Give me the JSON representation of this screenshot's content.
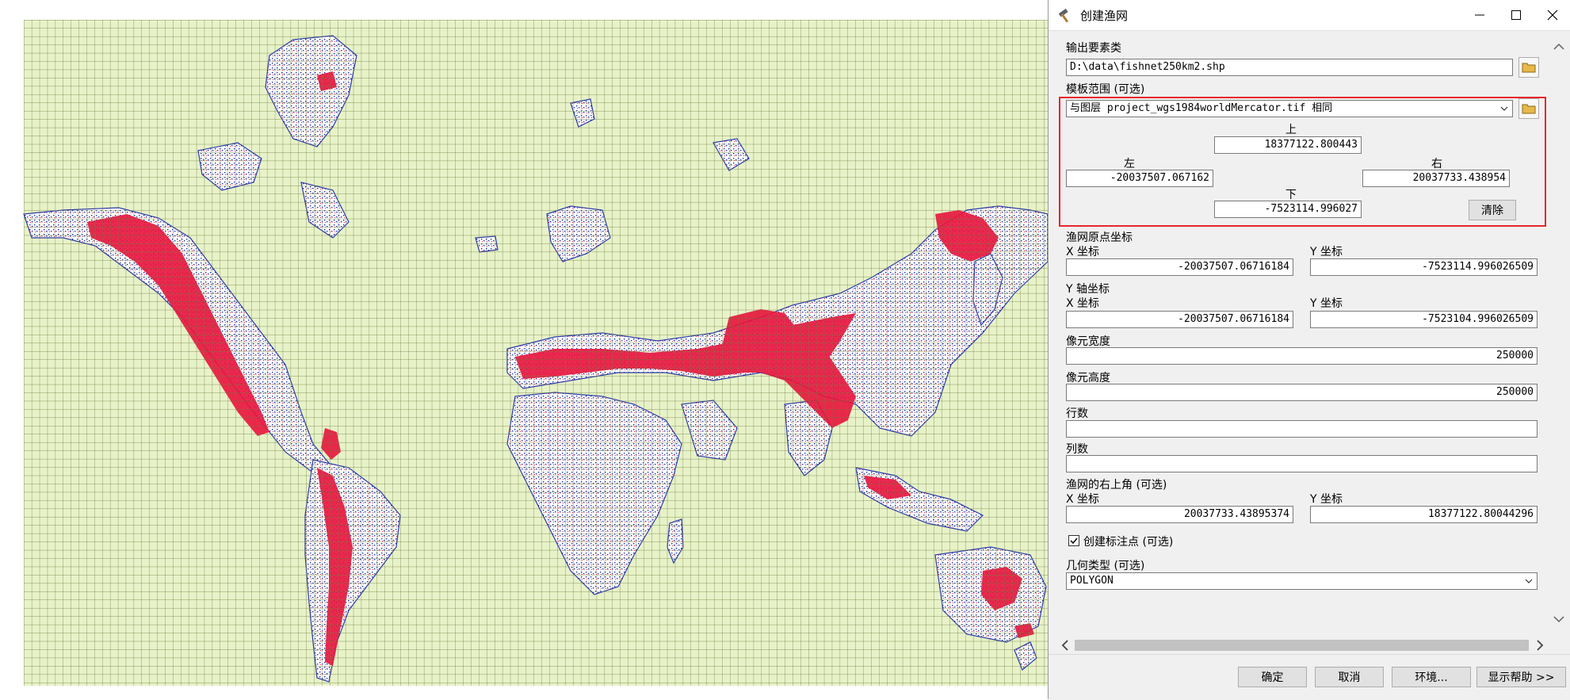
{
  "window": {
    "title": "创建渔网"
  },
  "colors": {
    "map_fill": "#e8f2c8",
    "grid_line": "#6a7a3a",
    "highlight_red": "#e8262d"
  },
  "output_features": {
    "label": "输出要素类",
    "value": "D:\\data\\fishnet250km2.shp"
  },
  "template_extent": {
    "label": "模板范围 (可选)",
    "selected": "与图层 project_wgs1984worldMercator.tif 相同",
    "top_label": "上",
    "top_value": "18377122.800443",
    "left_label": "左",
    "left_value": "-20037507.067162",
    "right_label": "右",
    "right_value": "20037733.438954",
    "bottom_label": "下",
    "bottom_value": "-7523114.996027",
    "clear_label": "清除"
  },
  "origin": {
    "label": "渔网原点坐标",
    "x_label": "X 坐标",
    "y_label": "Y 坐标",
    "x_value": "-20037507.06716184",
    "y_value": "-7523114.996026509"
  },
  "yaxis": {
    "label": "Y 轴坐标",
    "x_label": "X 坐标",
    "y_label": "Y 坐标",
    "x_value": "-20037507.06716184",
    "y_value": "-7523104.996026509"
  },
  "cell_width": {
    "label": "像元宽度",
    "value": "250000"
  },
  "cell_height": {
    "label": "像元高度",
    "value": "250000"
  },
  "rows": {
    "label": "行数",
    "value": ""
  },
  "cols": {
    "label": "列数",
    "value": ""
  },
  "corner": {
    "label": "渔网的右上角 (可选)",
    "x_label": "X 坐标",
    "y_label": "Y 坐标",
    "x_value": "20037733.43895374",
    "y_value": "18377122.80044296"
  },
  "labels_option": {
    "label": "创建标注点 (可选)",
    "checked": true
  },
  "geometry": {
    "label": "几何类型 (可选)",
    "value": "POLYGON"
  },
  "footer": {
    "ok": "确定",
    "cancel": "取消",
    "env": "环境...",
    "help": "显示帮助 >>"
  }
}
